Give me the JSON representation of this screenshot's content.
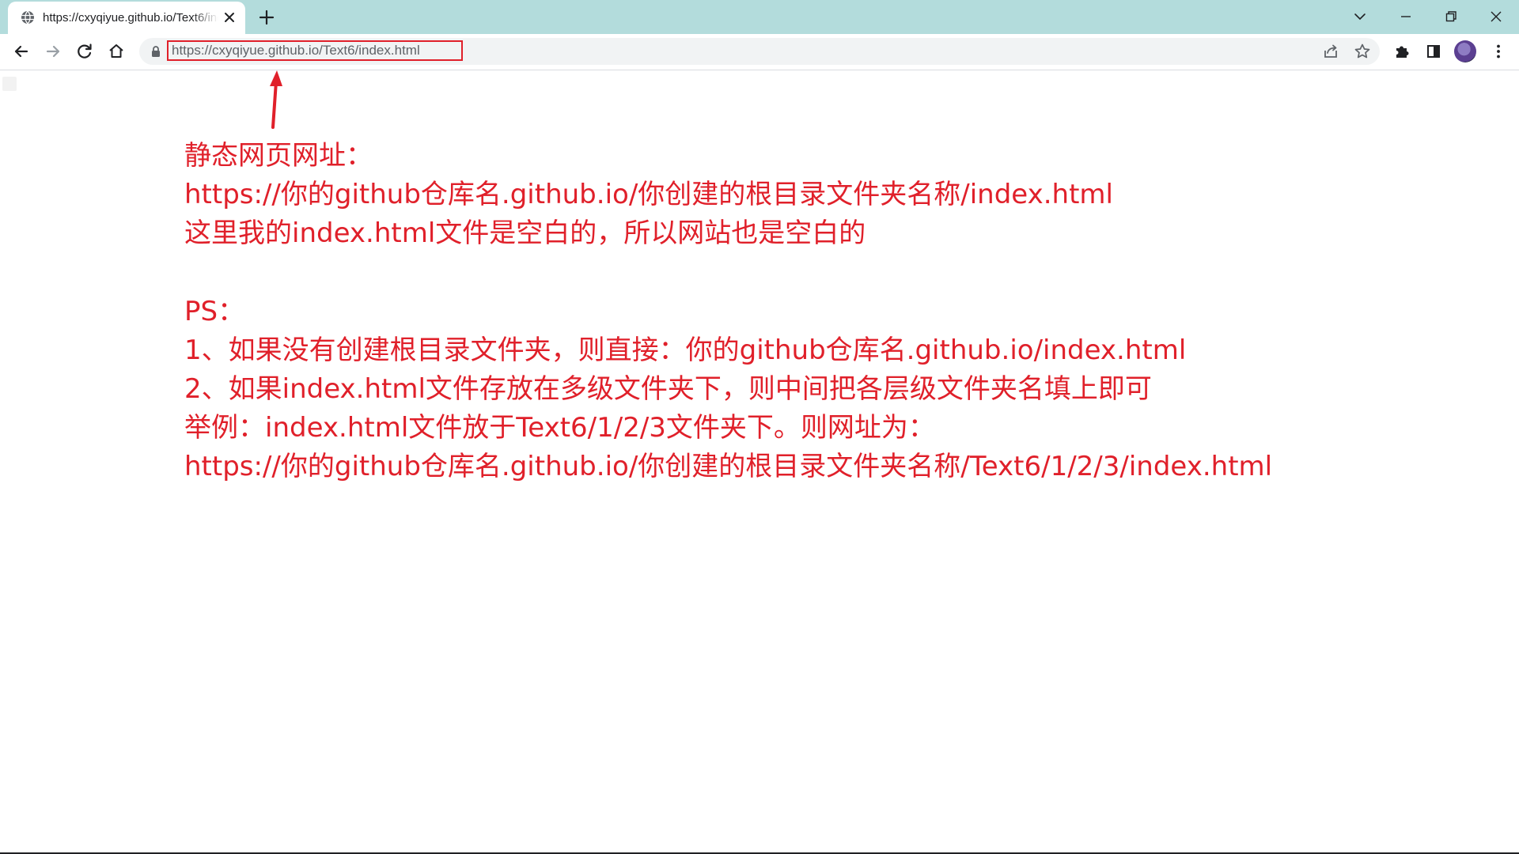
{
  "browser": {
    "tab": {
      "title": "https://cxyqiyue.github.io/Text6/index.html",
      "icon": "globe-icon",
      "close_icon": "close-icon"
    },
    "new_tab_icon": "plus-icon",
    "window_controls": [
      "chevron-down-icon",
      "minimize-icon",
      "restore-icon",
      "close-icon"
    ],
    "toolbar": {
      "back_icon": "back-arrow-icon",
      "forward_icon": "forward-arrow-icon",
      "reload_icon": "reload-icon",
      "home_icon": "home-icon"
    },
    "omnibox": {
      "url_host": "https://cxyqiyue.github.io",
      "url_path": "/Text6/index.html",
      "lock_icon": "lock-icon",
      "share_icon": "share-icon",
      "bookmark_icon": "star-icon"
    },
    "extensions_icon": "puzzle-icon",
    "side_panel_icon": "side-panel-icon",
    "profile_icon": "avatar",
    "menu_icon": "kebab-menu-icon"
  },
  "annotation": {
    "color": "#e0202a",
    "lines": [
      "静态网页网址：",
      "https://你的github仓库名.github.io/你创建的根目录文件夹名称/index.html",
      "这里我的index.html文件是空白的，所以网站也是空白的",
      "",
      "PS：",
      "1、如果没有创建根目录文件夹，则直接：你的github仓库名.github.io/index.html",
      "2、如果index.html文件存放在多级文件夹下，则中间把各层级文件夹名填上即可",
      "举例：index.html文件放于Text6/1/2/3文件夹下。则网址为：",
      "https://你的github仓库名.github.io/你创建的根目录文件夹名称/Text6/1/2/3/index.html"
    ]
  }
}
